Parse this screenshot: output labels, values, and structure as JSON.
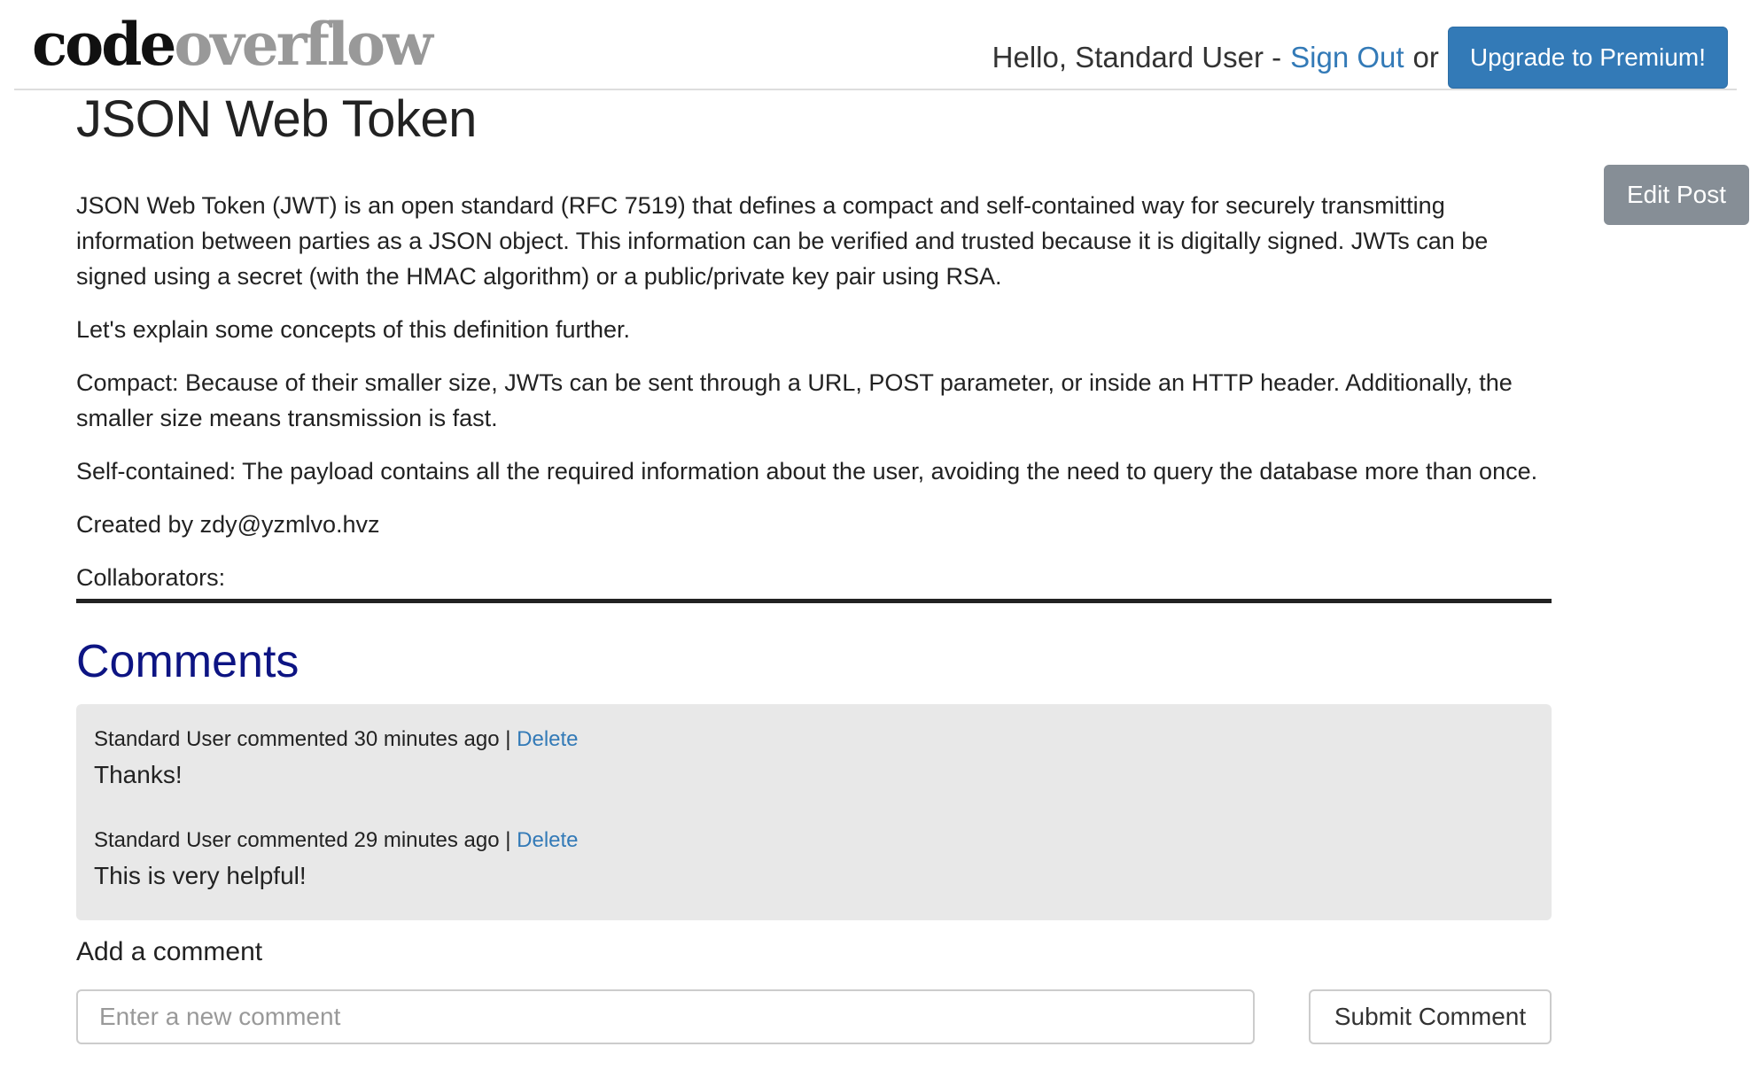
{
  "brand": {
    "part1": "code",
    "part2": "overflow"
  },
  "nav": {
    "greeting": "Hello, Standard User -",
    "sign_out": "Sign Out",
    "or": "or",
    "upgrade": "Upgrade to Premium!"
  },
  "post": {
    "title": "JSON Web Token",
    "edit_label": "Edit Post",
    "paragraphs": [
      "JSON Web Token (JWT) is an open standard (RFC 7519) that defines a compact and self-contained way for securely transmitting information between parties as a JSON object. This information can be verified and trusted because it is digitally signed. JWTs can be signed using a secret (with the HMAC algorithm) or a public/private key pair using RSA.",
      "Let's explain some concepts of this definition further.",
      "Compact: Because of their smaller size, JWTs can be sent through a URL, POST parameter, or inside an HTTP header. Additionally, the smaller size means transmission is fast.",
      "Self-contained: The payload contains all the required information about the user, avoiding the need to query the database more than once."
    ],
    "created_by": "Created by zdy@yzmlvo.hvz",
    "collaborators": "Collaborators:"
  },
  "comments": {
    "title": "Comments",
    "items": [
      {
        "meta": "Standard User commented 30 minutes ago |",
        "delete": "Delete",
        "body": "Thanks!"
      },
      {
        "meta": "Standard User commented 29 minutes ago |",
        "delete": "Delete",
        "body": "This is very helpful!"
      }
    ],
    "add_label": "Add a comment",
    "input_placeholder": "Enter a new comment",
    "submit_label": "Submit Comment"
  }
}
